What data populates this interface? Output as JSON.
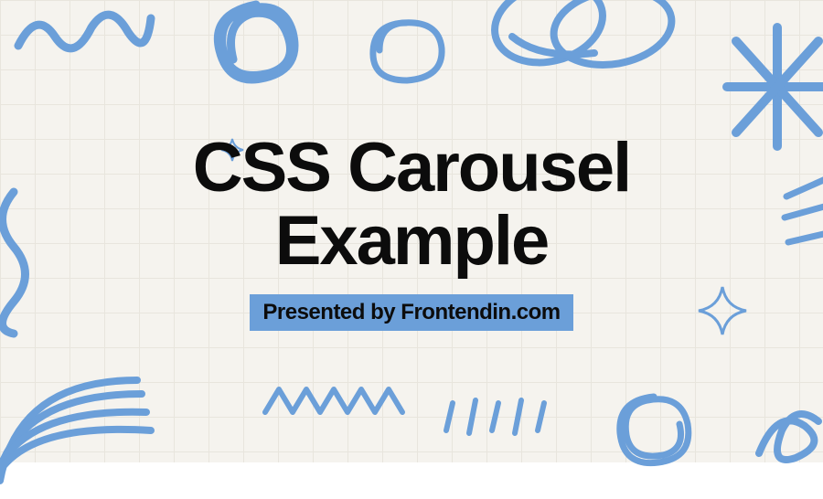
{
  "slide": {
    "title": "CSS Carousel Example",
    "subtitle": "Presented by Frontendin.com"
  },
  "colors": {
    "doodle": "#6b9fd9",
    "background": "#f5f3ee",
    "text": "#0c0c0c",
    "highlight": "#6b9fd9"
  }
}
